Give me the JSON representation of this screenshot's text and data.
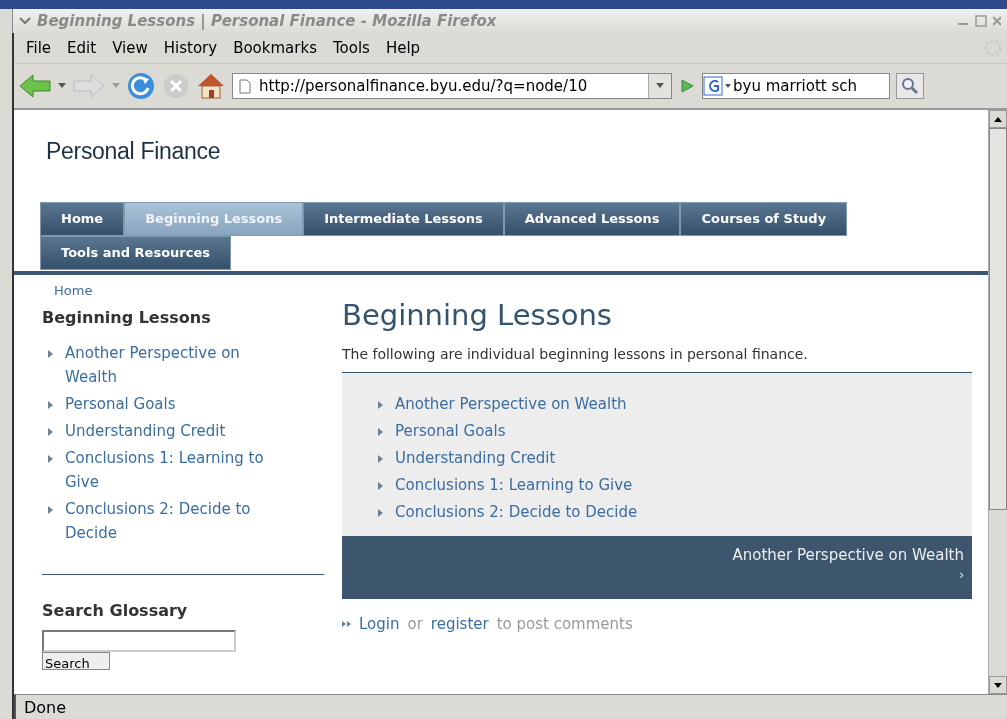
{
  "window": {
    "title": "Beginning Lessons | Personal Finance - Mozilla Firefox"
  },
  "menu": [
    "File",
    "Edit",
    "View",
    "History",
    "Bookmarks",
    "Tools",
    "Help"
  ],
  "toolbar": {
    "url": "http://personalfinance.byu.edu/?q=node/10",
    "search": "byu marriott sch"
  },
  "site": {
    "title": "Personal Finance"
  },
  "tabs": [
    {
      "label": "Home",
      "selected": false
    },
    {
      "label": "Beginning Lessons",
      "selected": true
    },
    {
      "label": "Intermediate Lessons",
      "selected": false
    },
    {
      "label": "Advanced Lessons",
      "selected": false
    },
    {
      "label": "Courses of Study",
      "selected": false
    },
    {
      "label": "Tools and Resources",
      "selected": false
    }
  ],
  "breadcrumb": "Home",
  "sidebar": {
    "heading": "Beginning Lessons",
    "items": [
      "Another Perspective on Wealth",
      "Personal Goals",
      "Understanding Credit",
      "Conclusions 1: Learning to Give",
      "Conclusions 2: Decide to Decide"
    ],
    "glossary": {
      "heading": "Search Glossary",
      "button": "Search"
    }
  },
  "main": {
    "heading": "Beginning Lessons",
    "intro": "The following are individual beginning lessons in personal finance.",
    "lessons": [
      "Another Perspective on Wealth",
      "Personal Goals",
      "Understanding Credit",
      "Conclusions 1: Learning to Give",
      "Conclusions 2: Decide to Decide"
    ],
    "next": {
      "label": "Another Perspective on Wealth",
      "arrow": "›"
    },
    "comments": {
      "login": "Login",
      "or": "or",
      "register": "register",
      "rest": "to post comments"
    }
  },
  "status_bar": "Done"
}
